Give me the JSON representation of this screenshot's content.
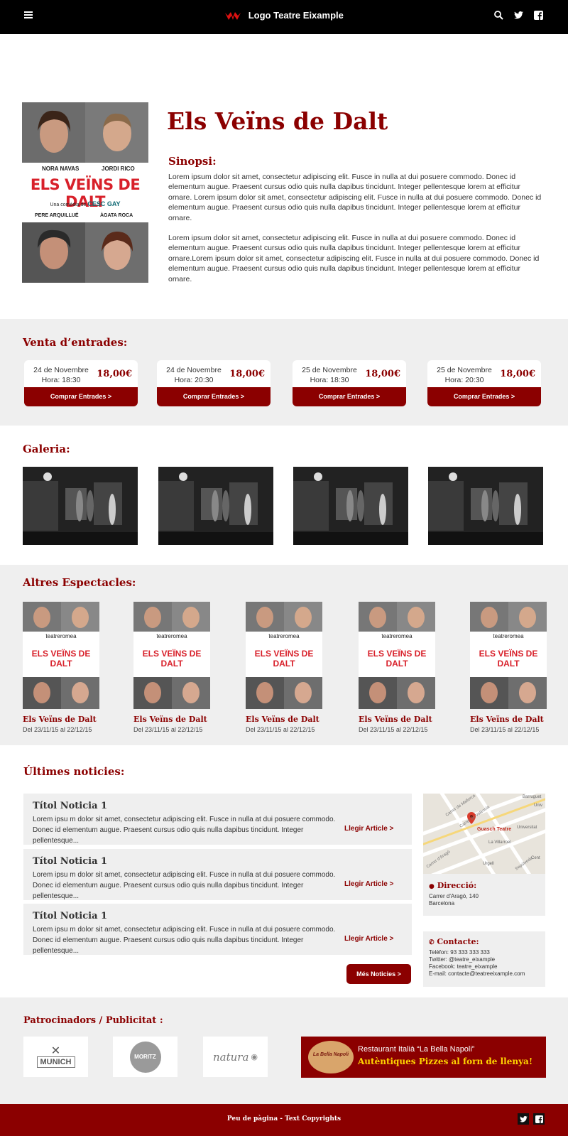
{
  "header": {
    "logo_text": "Logo Teatre Eixample",
    "menu_icon": "hamburger-icon",
    "icons": [
      "search-icon",
      "twitter-icon",
      "facebook-icon"
    ]
  },
  "show": {
    "title": "Els Veïns de Dalt",
    "synopsis_heading": "Sinopsi:",
    "paragraphs": [
      "Lorem ipsum dolor sit amet, consectetur adipiscing elit. Fusce in nulla at dui posuere commodo. Donec id elementum augue. Praesent cursus odio quis nulla dapibus tincidunt. Integer pellentesque lorem at efficitur ornare. Lorem ipsum dolor sit amet, consectetur adipiscing elit. Fusce in nulla at dui posuere commodo. Donec id elementum augue. Praesent cursus odio quis nulla dapibus tincidunt. Integer pellentesque lorem at efficitur ornare.",
      "Lorem ipsum dolor sit amet, consectetur adipiscing elit. Fusce in nulla at dui posuere commodo. Donec id elementum augue. Praesent cursus odio quis nulla dapibus tincidunt. Integer pellentesque lorem at efficitur ornare.Lorem ipsum dolor sit amet, consectetur adipiscing elit. Fusce in nulla at dui posuere commodo. Donec id elementum augue. Praesent cursus odio quis nulla dapibus tincidunt. Integer pellentesque lorem at efficitur ornare."
    ],
    "poster": {
      "actor1": "NORA NAVAS",
      "actor2": "JORDI RICO",
      "title": "ELS VEÏNS DE DALT",
      "subtitle_prefix": "Una comèdia de",
      "author": "CESC GAY",
      "actor3": "PERE ARQUILLUÉ",
      "actor4": "ÀGATA ROCA"
    }
  },
  "tickets": {
    "heading": "Venta d’entrades:",
    "items": [
      {
        "date": "24 de Novembre",
        "time": "Hora: 18:30",
        "price": "18,00€",
        "button": "Comprar Entrades >"
      },
      {
        "date": "24 de Novembre",
        "time": "Hora: 20:30",
        "price": "18,00€",
        "button": "Comprar Entrades >"
      },
      {
        "date": "25 de Novembre",
        "time": "Hora: 18:30",
        "price": "18,00€",
        "button": "Comprar Entrades >"
      },
      {
        "date": "25 de Novembre",
        "time": "Hora: 20:30",
        "price": "18,00€",
        "button": "Comprar Entrades >"
      }
    ]
  },
  "gallery": {
    "heading": "Galeria:"
  },
  "others": {
    "heading": "Altres Espectacles:",
    "poster_brand": "teatreromea",
    "items": [
      {
        "name": "Els Veïns de Dalt",
        "dates": "Del 23/11/15 al 22/12/15"
      },
      {
        "name": "Els Veïns de Dalt",
        "dates": "Del 23/11/15 al 22/12/15"
      },
      {
        "name": "Els Veïns de Dalt",
        "dates": "Del 23/11/15 al 22/12/15"
      },
      {
        "name": "Els Veïns de Dalt",
        "dates": "Del 23/11/15 al 22/12/15"
      },
      {
        "name": "Els Veïns de Dalt",
        "dates": "Del 23/11/15 al 22/12/15"
      }
    ]
  },
  "news": {
    "heading": "Últimes noticies:",
    "items": [
      {
        "title": "Títol Noticia 1",
        "text": "Lorem ipsu m dolor sit amet, consectetur adipiscing elit. Fusce in nulla at dui posuere commodo. Donec id elementum augue. Praesent cursus odio quis nulla dapibus tincidunt. Integer pellentesque...",
        "link": "Llegir Article >"
      },
      {
        "title": "Títol Noticia 1",
        "text": "Lorem ipsu m dolor sit amet, consectetur adipiscing elit. Fusce in nulla at dui posuere commodo. Donec id elementum augue. Praesent cursus odio quis nulla dapibus tincidunt. Integer pellentesque...",
        "link": "Llegir Article >"
      },
      {
        "title": "Títol Noticia 1",
        "text": "Lorem ipsu m dolor sit amet, consectetur adipiscing elit. Fusce in nulla at dui posuere commodo. Donec id elementum augue. Praesent cursus odio quis nulla dapibus tincidunt. Integer pellentesque...",
        "link": "Llegir Article >"
      }
    ],
    "more_button": "Més Noticies >"
  },
  "sidebar": {
    "map": {
      "pin_label": "Guasch Teatre",
      "streets": [
        "Carrer de Mallorca",
        "Carrer de València",
        "Carrer d'Aragó",
        "Barruguet",
        "Univ",
        "Universitat",
        "La Villarroel",
        "Urgell",
        "Sepúlveda",
        "Cent"
      ]
    },
    "address_label": "Direcció:",
    "address_lines": [
      "Carrer d'Aragó, 140",
      "Barcelona"
    ],
    "contact_label": "Contacte:",
    "contact_lines": [
      "Telèfon: 93 333 333 333",
      "Twitter: @teatre_eixample",
      "Facebook: teatre_eixample",
      "E-mail: contacte@teatreeixample.com"
    ]
  },
  "sponsors": {
    "heading": "Patrocinadors / Publicitat :",
    "logos": [
      "MUNICH",
      "MORITZ",
      "natura"
    ],
    "ad": {
      "badge": "La Bella Napoli",
      "line1": "Restaurant Italià “La Bella Napoli”",
      "line2": "Autèntiques Pizzes al forn de llenya!"
    }
  },
  "footer": {
    "copyright": "Peu de pàgina - Text Copyrights",
    "icons": [
      "twitter-icon",
      "facebook-icon"
    ]
  },
  "colors": {
    "brand": "#8b0000",
    "header_bg": "#000000",
    "section_bg": "#efefef",
    "ad_text": "#ffd400"
  }
}
